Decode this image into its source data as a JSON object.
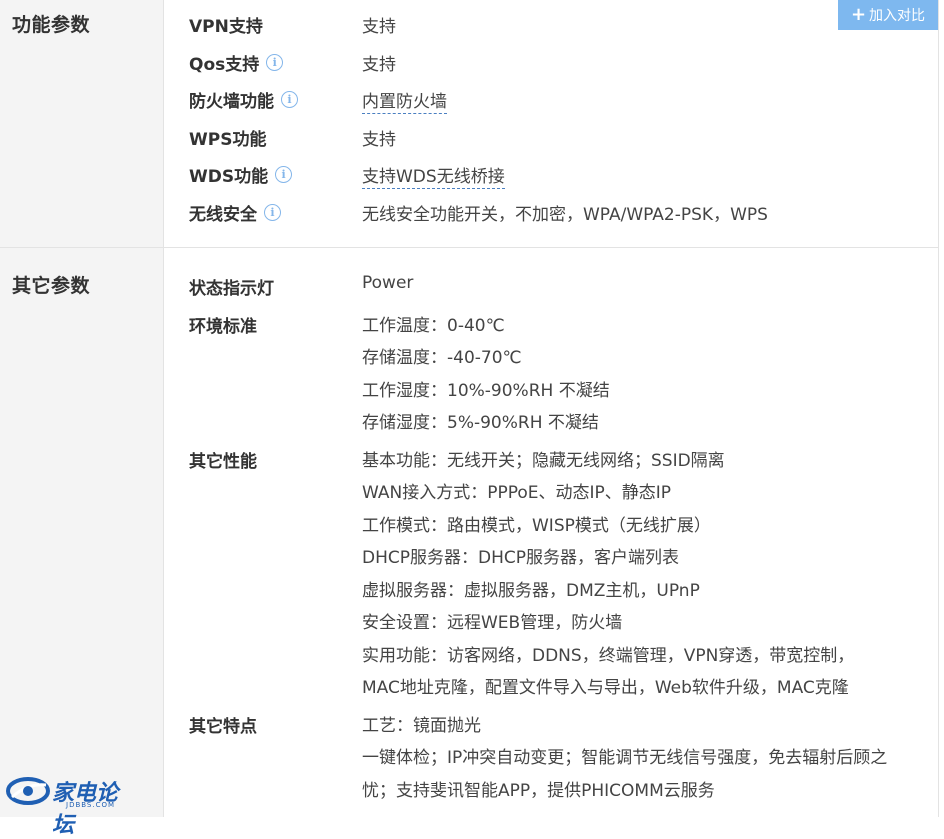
{
  "compare_button": {
    "label": "加入对比"
  },
  "sections": [
    {
      "title": "功能参数",
      "rows": [
        {
          "label": "VPN支持",
          "info": false,
          "values": [
            "支持"
          ],
          "link": false
        },
        {
          "label": "Qos支持",
          "info": true,
          "values": [
            "支持"
          ],
          "link": false
        },
        {
          "label": "防火墙功能",
          "info": true,
          "values": [
            "内置防火墙"
          ],
          "link": true
        },
        {
          "label": "WPS功能",
          "info": false,
          "values": [
            "支持"
          ],
          "link": false
        },
        {
          "label": "WDS功能",
          "info": true,
          "values": [
            "支持WDS无线桥接"
          ],
          "link": true
        },
        {
          "label": "无线安全",
          "info": true,
          "values": [
            "无线安全功能开关，不加密，WPA/WPA2-PSK，WPS"
          ],
          "link": false
        }
      ]
    },
    {
      "title": "其它参数",
      "rows": [
        {
          "label": "状态指示灯",
          "info": false,
          "values": [
            "Power"
          ]
        },
        {
          "label": "环境标准",
          "info": false,
          "values": [
            "工作温度：0-40℃",
            "存储温度：-40-70℃",
            "工作湿度：10%-90%RH 不凝结",
            "存储湿度：5%-90%RH 不凝结"
          ]
        },
        {
          "label": "其它性能",
          "info": false,
          "values": [
            "基本功能：无线开关；隐藏无线网络；SSID隔离",
            "WAN接入方式：PPPoE、动态IP、静态IP",
            "工作模式：路由模式，WISP模式（无线扩展）",
            "DHCP服务器：DHCP服务器，客户端列表",
            "虚拟服务器：虚拟服务器，DMZ主机，UPnP",
            "安全设置：远程WEB管理，防火墙",
            "实用功能：访客网络，DDNS，终端管理，VPN穿透，带宽控制，",
            "MAC地址克隆，配置文件导入与导出，Web软件升级，MAC克隆"
          ]
        },
        {
          "label": "其它特点",
          "info": false,
          "values": [
            "工艺：镜面抛光",
            "一键体检；IP冲突自动变更；智能调节无线信号强度，免去辐射后顾之",
            "忧；支持斐讯智能APP，提供PHICOMM云服务"
          ]
        }
      ]
    }
  ],
  "watermark": {
    "brand": "家电论坛",
    "domain": "JDBBS.COM"
  },
  "icons": {
    "info": "info-circle-icon",
    "plus": "plus-icon",
    "logo": "jdbbs-logo-icon"
  },
  "colors": {
    "info_icon": "#84b6ea",
    "compare_button": "#7eb8ef",
    "link_underline": "#4a7fc1",
    "category_bg": "#f4f4f4"
  }
}
